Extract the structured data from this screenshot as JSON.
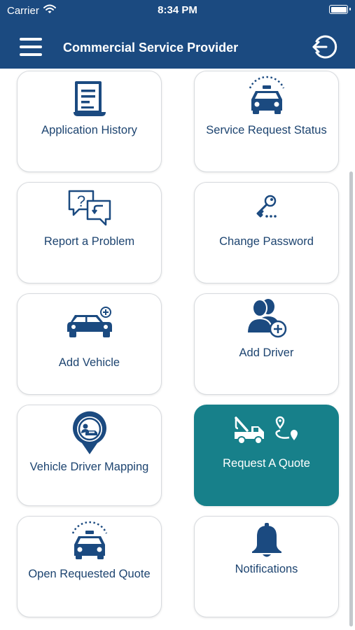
{
  "status_bar": {
    "carrier": "Carrier",
    "time": "8:34 PM"
  },
  "header": {
    "title": "Commercial Service Provider"
  },
  "cards": [
    {
      "label": "Application History",
      "icon": "document-history-icon",
      "active": false
    },
    {
      "label": "Service Request Status",
      "icon": "taxi-status-icon",
      "active": false
    },
    {
      "label": "Report a Problem",
      "icon": "question-chat-icon",
      "active": false
    },
    {
      "label": "Change Password",
      "icon": "key-icon",
      "active": false
    },
    {
      "label": "Add Vehicle",
      "icon": "car-add-icon",
      "active": false
    },
    {
      "label": "Add Driver",
      "icon": "users-add-icon",
      "active": false
    },
    {
      "label": "Vehicle Driver Mapping",
      "icon": "map-pin-car-icon",
      "active": false
    },
    {
      "label": "Request A Quote",
      "icon": "tow-truck-route-icon",
      "active": true
    },
    {
      "label": "Open Requested Quote",
      "icon": "taxi-quote-icon",
      "active": false
    },
    {
      "label": "Notifications",
      "icon": "bell-icon",
      "active": false
    }
  ],
  "colors": {
    "header": "#1b4a80",
    "active_card": "#17808a",
    "text": "#1d4470",
    "icon": "#1b4a80"
  }
}
